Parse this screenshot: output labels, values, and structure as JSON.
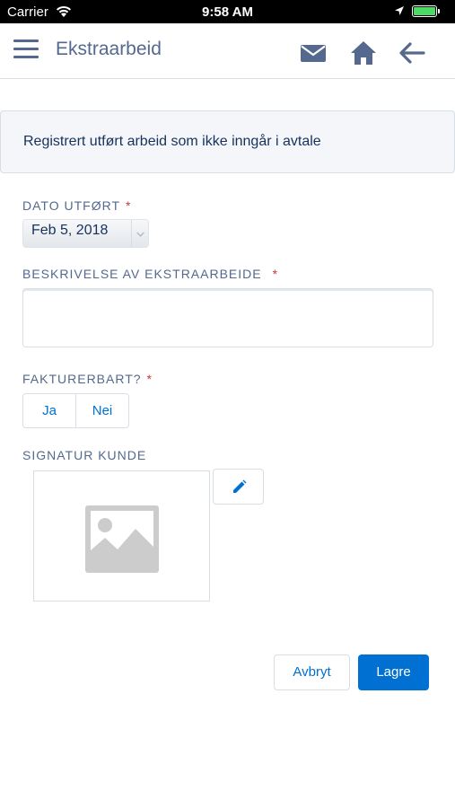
{
  "status_bar": {
    "carrier": "Carrier",
    "time": "9:58 AM",
    "icons": [
      "wifi-icon",
      "location-icon",
      "battery-icon"
    ],
    "battery_color": "#4cd964"
  },
  "nav": {
    "title": "Ekstraarbeid",
    "icons": [
      "menu-icon",
      "mail-icon",
      "home-icon",
      "back-arrow-icon"
    ],
    "icon_color": "#54698d"
  },
  "info": {
    "text": "Registrert utført arbeid som ikke inngår i avtale"
  },
  "form": {
    "date": {
      "label": "DATO UTFØRT",
      "required_mark": "*",
      "value": "Feb 5, 2018"
    },
    "description": {
      "label": "BESKRIVELSE AV EKSTRAARBEIDE",
      "required_mark": "*",
      "value": ""
    },
    "billable": {
      "label": "FAKTURERBART?",
      "required_mark": "*",
      "options": [
        "Ja",
        "Nei"
      ]
    },
    "signature": {
      "label": "SIGNATUR KUNDE",
      "placeholder_icon": "image-placeholder-icon",
      "edit_icon": "pencil-icon"
    }
  },
  "actions": {
    "cancel_label": "Avbryt",
    "save_label": "Lagre",
    "primary_color": "#0070d2"
  }
}
